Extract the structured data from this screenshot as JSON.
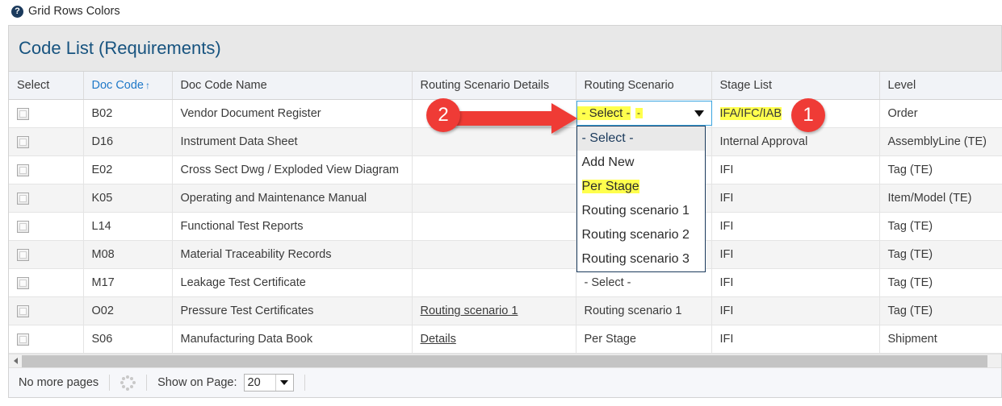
{
  "help": {
    "icon": "help-circle-icon",
    "label": "Grid Rows Colors"
  },
  "panel": {
    "title": "Code List (Requirements)"
  },
  "grid": {
    "columns": [
      {
        "key": "select",
        "label": "Select",
        "sortable": false
      },
      {
        "key": "doc_code",
        "label": "Doc Code",
        "sortable": true,
        "sort_dir": "↑"
      },
      {
        "key": "doc_code_name",
        "label": "Doc Code Name",
        "sortable": false
      },
      {
        "key": "routing_scenario_details",
        "label": "Routing Scenario Details",
        "sortable": false
      },
      {
        "key": "routing_scenario",
        "label": "Routing Scenario",
        "sortable": false
      },
      {
        "key": "stage_list",
        "label": "Stage List",
        "sortable": false
      },
      {
        "key": "level",
        "label": "Level",
        "sortable": false
      }
    ],
    "rows": [
      {
        "doc_code": "B02",
        "doc_code_name": "Vendor Document Register",
        "routing_scenario_details": "",
        "routing_scenario": "- Select -",
        "routing_scenario_is_dropdown": true,
        "stage_list": "IFA/IFC/IAB",
        "stage_list_highlighted": true,
        "level": "Order"
      },
      {
        "doc_code": "D16",
        "doc_code_name": "Instrument Data Sheet",
        "routing_scenario_details": "",
        "routing_scenario": "",
        "stage_list": "Internal Approval",
        "level": "AssemblyLine (TE)"
      },
      {
        "doc_code": "E02",
        "doc_code_name": "Cross Sect Dwg / Exploded View Diagram",
        "routing_scenario_details": "",
        "routing_scenario": "",
        "stage_list": "IFI",
        "level": "Tag (TE)"
      },
      {
        "doc_code": "K05",
        "doc_code_name": "Operating and Maintenance Manual",
        "routing_scenario_details": "",
        "routing_scenario": "",
        "stage_list": "IFI",
        "level": "Item/Model (TE)"
      },
      {
        "doc_code": "L14",
        "doc_code_name": "Functional Test Reports",
        "routing_scenario_details": "",
        "routing_scenario": "",
        "stage_list": "IFI",
        "level": "Tag (TE)"
      },
      {
        "doc_code": "M08",
        "doc_code_name": "Material Traceability Records",
        "routing_scenario_details": "",
        "routing_scenario": "",
        "stage_list": "IFI",
        "level": "Tag (TE)"
      },
      {
        "doc_code": "M17",
        "doc_code_name": "Leakage Test Certificate",
        "routing_scenario_details": "",
        "routing_scenario": "- Select -",
        "stage_list": "IFI",
        "level": "Tag (TE)"
      },
      {
        "doc_code": "O02",
        "doc_code_name": "Pressure Test Certificates",
        "routing_scenario_details": "Routing scenario 1",
        "routing_scenario_details_is_link": true,
        "routing_scenario": "Routing scenario 1",
        "stage_list": "IFI",
        "level": "Tag (TE)"
      },
      {
        "doc_code": "S06",
        "doc_code_name": "Manufacturing Data Book",
        "routing_scenario_details": "Details",
        "routing_scenario_details_is_link": true,
        "routing_scenario": "Per Stage",
        "stage_list": "IFI",
        "level": "Shipment"
      }
    ]
  },
  "dropdown": {
    "selected_label": "- Select -",
    "selected_highlighted": true,
    "trailing_mark": "-",
    "caret_icon": "chevron-down-icon",
    "options": [
      {
        "label": "- Select -",
        "state": "selected"
      },
      {
        "label": "Add New",
        "state": "normal"
      },
      {
        "label": "Per Stage",
        "state": "highlighted"
      },
      {
        "label": "Routing scenario 1",
        "state": "normal"
      },
      {
        "label": "Routing scenario 2",
        "state": "normal"
      },
      {
        "label": "Routing scenario 3",
        "state": "normal"
      }
    ]
  },
  "annotations": [
    {
      "id": "marker-1",
      "label": "1",
      "color": "#ef3b36",
      "kind": "circle-badge"
    },
    {
      "id": "marker-2",
      "label": "2",
      "color": "#ef3b36",
      "kind": "circle-badge-with-arrow"
    }
  ],
  "scrollbar": {
    "left_arrow_icon": "caret-left-icon"
  },
  "footer": {
    "pages_status": "No more pages",
    "spinner_icon": "loading-spinner-icon",
    "show_on_page_label": "Show on Page:",
    "show_on_page_value": "20",
    "show_on_page_caret_icon": "chevron-down-icon"
  },
  "colors": {
    "accent_blue": "#17537f",
    "link_blue": "#2079c8",
    "highlight_yellow": "#ffff4d",
    "annotation_red": "#ef3b36",
    "header_grey": "#e8e8e8",
    "col_header_grey": "#f1f3f7",
    "row_alt_grey": "#f4f4f4"
  }
}
